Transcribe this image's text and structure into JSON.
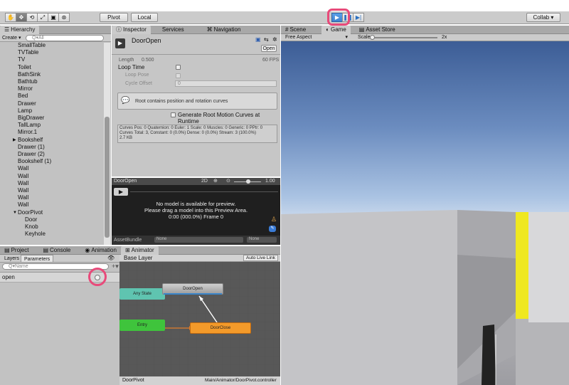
{
  "toolbar": {
    "tools": [
      "hand-icon",
      "move-icon",
      "rotate-icon",
      "scale-icon",
      "rect-icon",
      "transform-icon"
    ],
    "pivot_label": "Pivot",
    "local_label": "Local",
    "collab_label": "Collab ▾",
    "play_buttons": [
      "play-icon",
      "pause-icon",
      "step-icon"
    ]
  },
  "hierarchy": {
    "tab": "Hierarchy",
    "create_label": "Create ▾",
    "search_placeholder": "Q▾All",
    "items": [
      "SmallTable",
      "TVTable",
      "TV",
      "Toilet",
      "BathSink",
      "Bathtub",
      "Mirror",
      "Bed",
      "Drawer",
      "Lamp",
      "BigDrawer",
      "TallLamp",
      "Mirror.1",
      "Bookshelf",
      "Drawer (1)",
      "Drawer (2)",
      "Bookshelf (1)",
      "Wall",
      "Wall",
      "Wall",
      "Wall",
      "Wall",
      "Wall",
      "DoorPivot",
      "Door",
      "Knob",
      "Keyhole"
    ]
  },
  "inspector": {
    "tabs": [
      "Inspector",
      "Services",
      "Navigation"
    ],
    "title": "DoorOpen",
    "open_label": "Open",
    "length_label": "Length",
    "length_value": "0.500",
    "fps": "60 FPS",
    "loop_time": "Loop Time",
    "loop_pose": "Loop Pose",
    "cycle_offset": "Cycle Offset",
    "cycle_offset_value": "0",
    "info": "Root contains position and rotation curves",
    "generate_root": "Generate Root Motion Curves at Runtime",
    "curves_line1": "Curves Pos: 0 Quaternion: 0 Euler: 1 Scale: 0 Muscles: 0 Generic: 0 PPtr: 0",
    "curves_line2": "Curves Total: 3, Constant: 0 (0.0%) Dense: 0 (0.0%) Stream: 3 (100.0%)",
    "curves_line3": "2.7 KB"
  },
  "preview": {
    "name": "DoorOpen",
    "mode": "2D",
    "speed": "1.00",
    "msg1": "No model is available for preview.",
    "msg2": "Please drag a model into this Preview Area.",
    "msg3": "0:00 (000.0%) Frame 0",
    "asset_bundle_label": "AssetBundle",
    "asset_bundle_value": "None",
    "variant_value": "None"
  },
  "bottom_tabs": [
    "Project",
    "Console",
    "Animation",
    "Animator"
  ],
  "animator": {
    "left_tabs": [
      "Layers",
      "Parameters"
    ],
    "search_placeholder": "Q▾Name",
    "param_name": "open",
    "layer": "Base Layer",
    "auto_live_link": "Auto Live Link",
    "states": {
      "any": "Any State",
      "entry": "Entry",
      "door_open": "DoorOpen",
      "door_close": "DoorClose"
    },
    "footer_left": "DoorPivot",
    "footer_right": "Main/Animator/DoorPivot.controller"
  },
  "scene": {
    "tabs": [
      "Scene",
      "Game",
      "Asset Store"
    ],
    "aspect": "Free Aspect",
    "scale_label": "Scale",
    "scale_value": "2x"
  }
}
